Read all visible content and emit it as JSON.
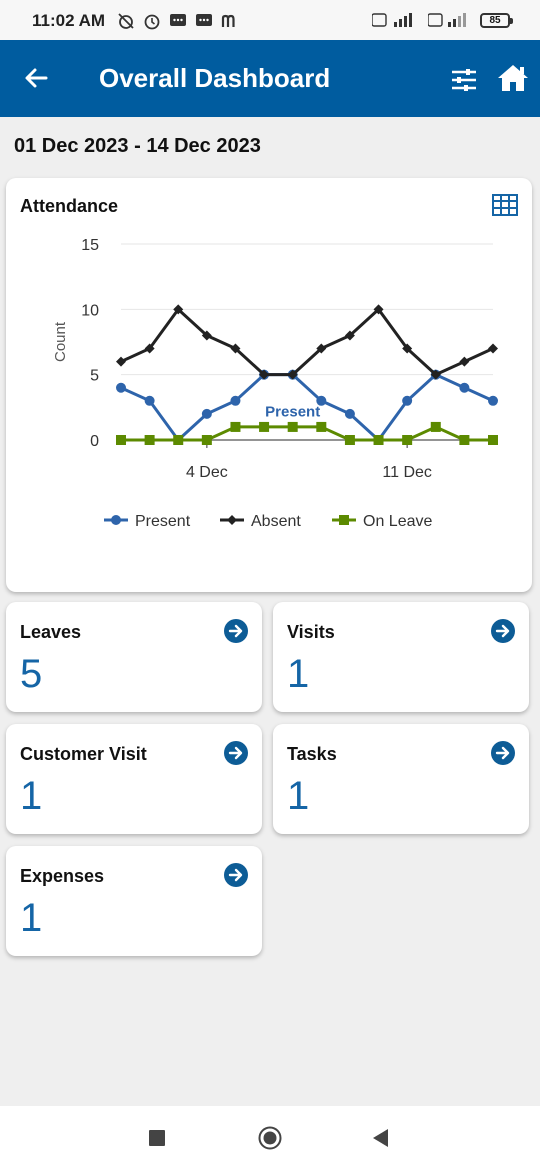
{
  "status_bar": {
    "time": "11:02 AM",
    "battery": "85"
  },
  "header": {
    "title": "Overall Dashboard"
  },
  "date_range": "01 Dec 2023 - 14 Dec 2023",
  "attendance": {
    "title": "Attendance",
    "chart_data": {
      "type": "line",
      "ylabel": "Count",
      "ylim": [
        0,
        15
      ],
      "yticks": [
        0,
        5,
        10,
        15
      ],
      "x": [
        1,
        2,
        3,
        4,
        5,
        6,
        7,
        8,
        9,
        10,
        11,
        12,
        13,
        14
      ],
      "xtick_labels": [
        {
          "x": 4,
          "label": "4 Dec"
        },
        {
          "x": 11,
          "label": "11 Dec"
        }
      ],
      "series": [
        {
          "name": "Present",
          "color": "#2e64ab",
          "marker": "circle",
          "values": [
            4,
            3,
            0,
            2,
            3,
            5,
            5,
            3,
            2,
            0,
            3,
            5,
            4,
            3
          ]
        },
        {
          "name": "Absent",
          "color": "#222222",
          "marker": "diamond",
          "values": [
            6,
            7,
            10,
            8,
            7,
            5,
            5,
            7,
            8,
            10,
            7,
            5,
            6,
            7
          ]
        },
        {
          "name": "On Leave",
          "color": "#5c8a00",
          "marker": "square",
          "values": [
            0,
            0,
            0,
            0,
            1,
            1,
            1,
            1,
            0,
            0,
            0,
            1,
            0,
            0
          ]
        }
      ],
      "annotation": "Present",
      "legend_position": "bottom"
    }
  },
  "stats": [
    {
      "label": "Leaves",
      "value": "5"
    },
    {
      "label": "Visits",
      "value": "1"
    },
    {
      "label": "Customer Visit",
      "value": "1"
    },
    {
      "label": "Tasks",
      "value": "1"
    },
    {
      "label": "Expenses",
      "value": "1"
    }
  ]
}
